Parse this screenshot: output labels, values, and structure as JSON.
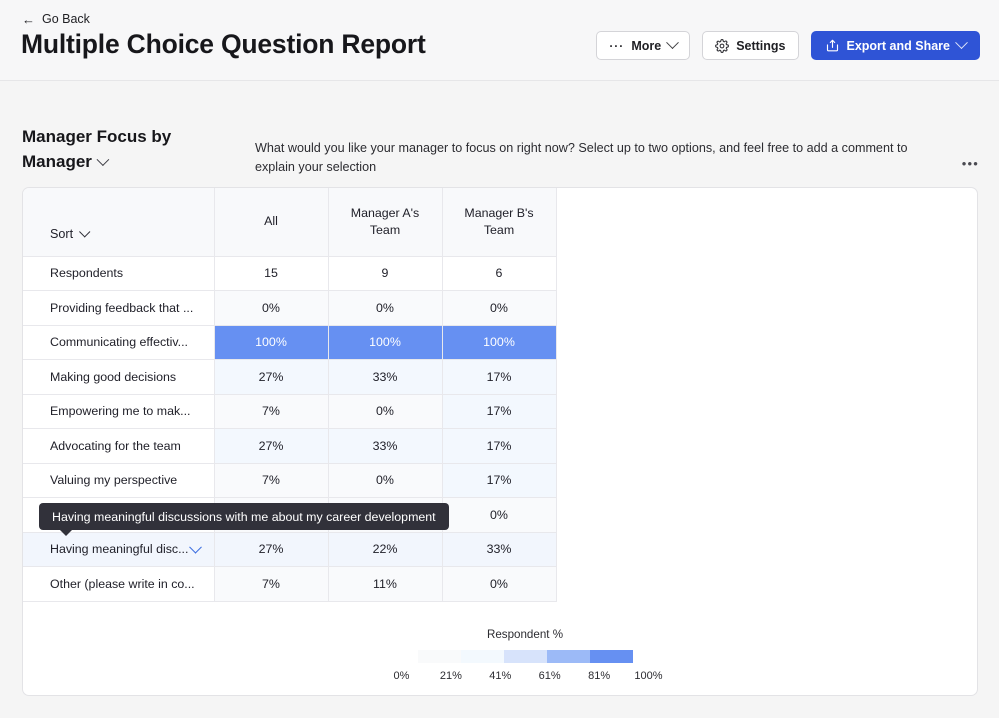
{
  "topbar": {
    "go_back": "Go Back",
    "back_arrow_icon": "arrow-left-icon",
    "title": "Multiple Choice Question Report",
    "buttons": [
      {
        "label": "More",
        "icon": "ellipsis-icon",
        "chevron": true,
        "primary": false
      },
      {
        "label": "Settings",
        "icon": "gear-icon",
        "chevron": false,
        "primary": false
      },
      {
        "label": "Export and Share",
        "icon": "share-icon",
        "chevron": true,
        "primary": true
      }
    ]
  },
  "section": {
    "title": "Manager Focus by Manager",
    "title_chevron_icon": "chevron-down-icon",
    "description": "What would you like your manager to focus on right now? Select up to two options, and feel free to add a comment to explain your selection",
    "more_menu_icon": "ellipsis-horizontal-icon",
    "more_menu_label": "•••"
  },
  "table": {
    "sort_label": "Sort",
    "sort_chevron_icon": "chevron-down-icon",
    "columns": [
      "All",
      "Manager A's Team",
      "Manager B's Team"
    ],
    "rows": [
      {
        "label": "Respondents",
        "values": [
          "15",
          "9",
          "6"
        ],
        "shades": [
          "h0",
          "h0",
          "h0"
        ],
        "hovered": false
      },
      {
        "label": "Providing feedback that ...",
        "values": [
          "0%",
          "0%",
          "0%"
        ],
        "shades": [
          "h1",
          "h1",
          "h1"
        ],
        "hovered": false
      },
      {
        "label": "Communicating effectiv...",
        "values": [
          "100%",
          "100%",
          "100%"
        ],
        "shades": [
          "h5",
          "h5",
          "h5"
        ],
        "hovered": false
      },
      {
        "label": "Making good decisions",
        "values": [
          "27%",
          "33%",
          "17%"
        ],
        "shades": [
          "h2",
          "h2",
          "h2"
        ],
        "hovered": false
      },
      {
        "label": "Empowering me to mak...",
        "values": [
          "7%",
          "0%",
          "17%"
        ],
        "shades": [
          "h1",
          "h1",
          "h2"
        ],
        "hovered": false
      },
      {
        "label": "Advocating for the team",
        "values": [
          "27%",
          "33%",
          "17%"
        ],
        "shades": [
          "h2",
          "h2",
          "h2"
        ],
        "hovered": false
      },
      {
        "label": "Valuing my perspective",
        "values": [
          "7%",
          "0%",
          "17%"
        ],
        "shades": [
          "h1",
          "h1",
          "h2"
        ],
        "hovered": false
      },
      {
        "label": "Having meaningful disc...",
        "values": [
          "",
          "",
          "0%"
        ],
        "shades": [
          "h1",
          "h1",
          "h1"
        ],
        "hovered": false
      },
      {
        "label": "Having meaningful disc...",
        "values": [
          "27%",
          "22%",
          "33%"
        ],
        "shades": [
          "h2",
          "h2",
          "h2"
        ],
        "hovered": true
      },
      {
        "label": "Other (please write in co...",
        "values": [
          "7%",
          "11%",
          "0%"
        ],
        "shades": [
          "h1",
          "h1",
          "h1"
        ],
        "hovered": false
      }
    ]
  },
  "tooltip": {
    "text": "Having meaningful discussions with me about my career development"
  },
  "legend": {
    "title": "Respondent %",
    "swatches": [
      "#f9fafb",
      "#f3f9fe",
      "#d7e3fb",
      "#9cbaf7",
      "#6690f2"
    ],
    "ticks": [
      "0%",
      "21%",
      "41%",
      "61%",
      "81%",
      "100%"
    ]
  }
}
